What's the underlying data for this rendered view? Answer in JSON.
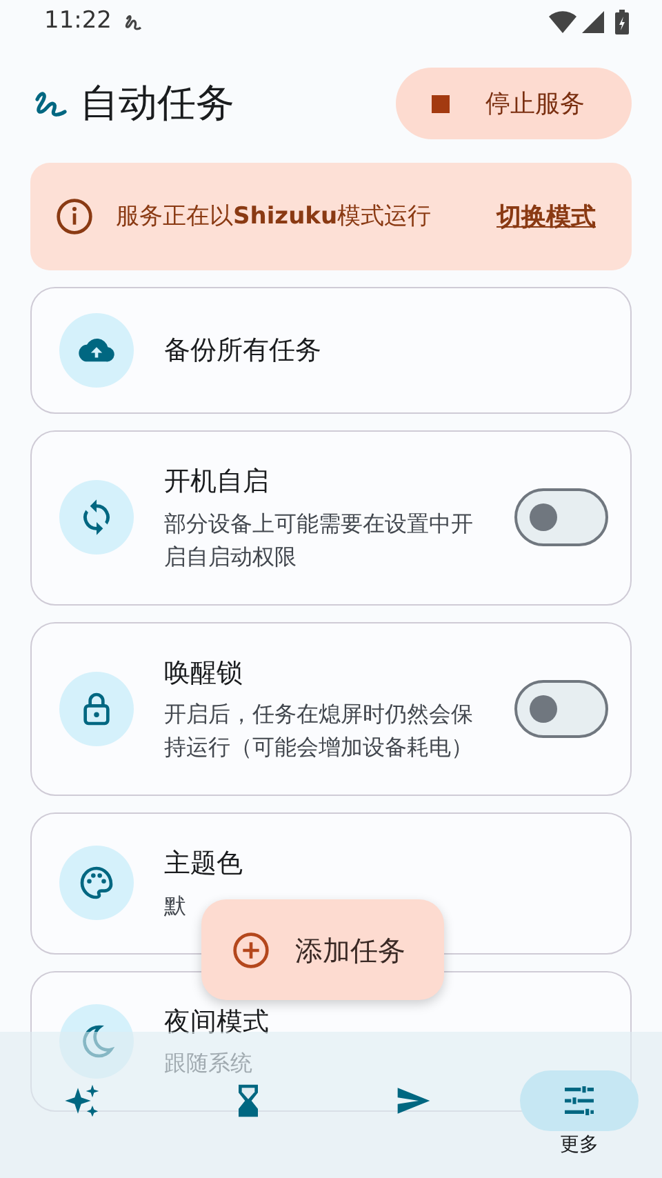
{
  "status_bar": {
    "time": "11:22"
  },
  "header": {
    "title": "自动任务",
    "stop_button": "停止服务"
  },
  "banner": {
    "message": "服务正在以**Shizuku**模式运行",
    "action": "切换模式"
  },
  "settings": [
    {
      "kind": "action",
      "title": "备份所有任务"
    },
    {
      "kind": "switch",
      "title": "开机自启",
      "subtitle": "部分设备上可能需要在设置中开启自启动权限",
      "on": false
    },
    {
      "kind": "switch",
      "title": "唤醒锁",
      "subtitle": "开启后，任务在熄屏时仍然会保持运行（可能会增加设备耗电）",
      "on": false
    },
    {
      "kind": "value",
      "title": "主题色",
      "subtitle": "默"
    },
    {
      "kind": "value",
      "title": "夜间模式",
      "subtitle": "跟随系统"
    }
  ],
  "fab": {
    "label": "添加任务"
  },
  "bottom_nav": [
    {
      "selected": false
    },
    {
      "selected": false
    },
    {
      "selected": false
    },
    {
      "selected": true,
      "label": "更多"
    }
  ]
}
